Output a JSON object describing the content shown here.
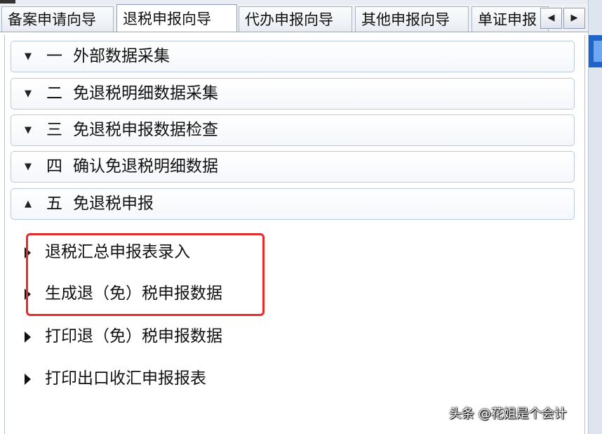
{
  "tabs": [
    {
      "label": "备案申请向导",
      "active": false
    },
    {
      "label": "退税申报向导",
      "active": true
    },
    {
      "label": "代办申报向导",
      "active": false
    },
    {
      "label": "其他申报向导",
      "active": false
    },
    {
      "label": "单证申报",
      "active": false
    }
  ],
  "tab_scroll": {
    "left": "◀",
    "right": "▶"
  },
  "sections": [
    {
      "num": "一",
      "title": "外部数据采集",
      "expanded": false,
      "caret": "▼"
    },
    {
      "num": "二",
      "title": "免退税明细数据采集",
      "expanded": false,
      "caret": "▼"
    },
    {
      "num": "三",
      "title": "免退税申报数据检查",
      "expanded": false,
      "caret": "▼"
    },
    {
      "num": "四",
      "title": "确认免退税明细数据",
      "expanded": false,
      "caret": "▼"
    },
    {
      "num": "五",
      "title": "免退税申报",
      "expanded": true,
      "caret": "▲"
    }
  ],
  "sub_items": [
    {
      "label": "退税汇总申报表录入",
      "highlighted": true
    },
    {
      "label": "生成退（免）税申报数据",
      "highlighted": true
    },
    {
      "label": "打印退（免）税申报数据",
      "highlighted": false
    },
    {
      "label": "打印出口收汇申报报表",
      "highlighted": false
    }
  ],
  "watermark": "头条 @花姐是个会计",
  "colors": {
    "highlight": "#e52b2b",
    "section_border": "#b9c9dc"
  }
}
